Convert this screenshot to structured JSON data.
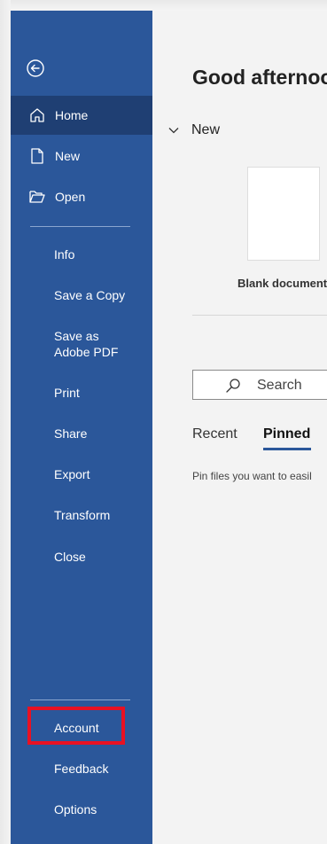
{
  "sidebar": {
    "nav_top": [
      {
        "label": "Home",
        "icon": "home-icon"
      },
      {
        "label": "New",
        "icon": "new-document-icon"
      },
      {
        "label": "Open",
        "icon": "folder-open-icon"
      }
    ],
    "nav_middle": [
      {
        "label": "Info"
      },
      {
        "label": "Save a Copy"
      },
      {
        "label": "Save as Adobe PDF"
      },
      {
        "label": "Print"
      },
      {
        "label": "Share"
      },
      {
        "label": "Export"
      },
      {
        "label": "Transform"
      },
      {
        "label": "Close"
      }
    ],
    "nav_bottom": [
      {
        "label": "Account"
      },
      {
        "label": "Feedback"
      },
      {
        "label": "Options"
      }
    ],
    "colors": {
      "background": "#2b579a",
      "active": "#1f3f73",
      "highlight_box": "#e81123"
    }
  },
  "main": {
    "greeting": "Good afternoo",
    "new_section": {
      "label": "New"
    },
    "templates": [
      {
        "label": "Blank document"
      }
    ],
    "search": {
      "placeholder": "Search"
    },
    "tabs": [
      {
        "label": "Recent"
      },
      {
        "label": "Pinned",
        "active": true
      }
    ],
    "pinned_message": "Pin files you want to easil"
  }
}
